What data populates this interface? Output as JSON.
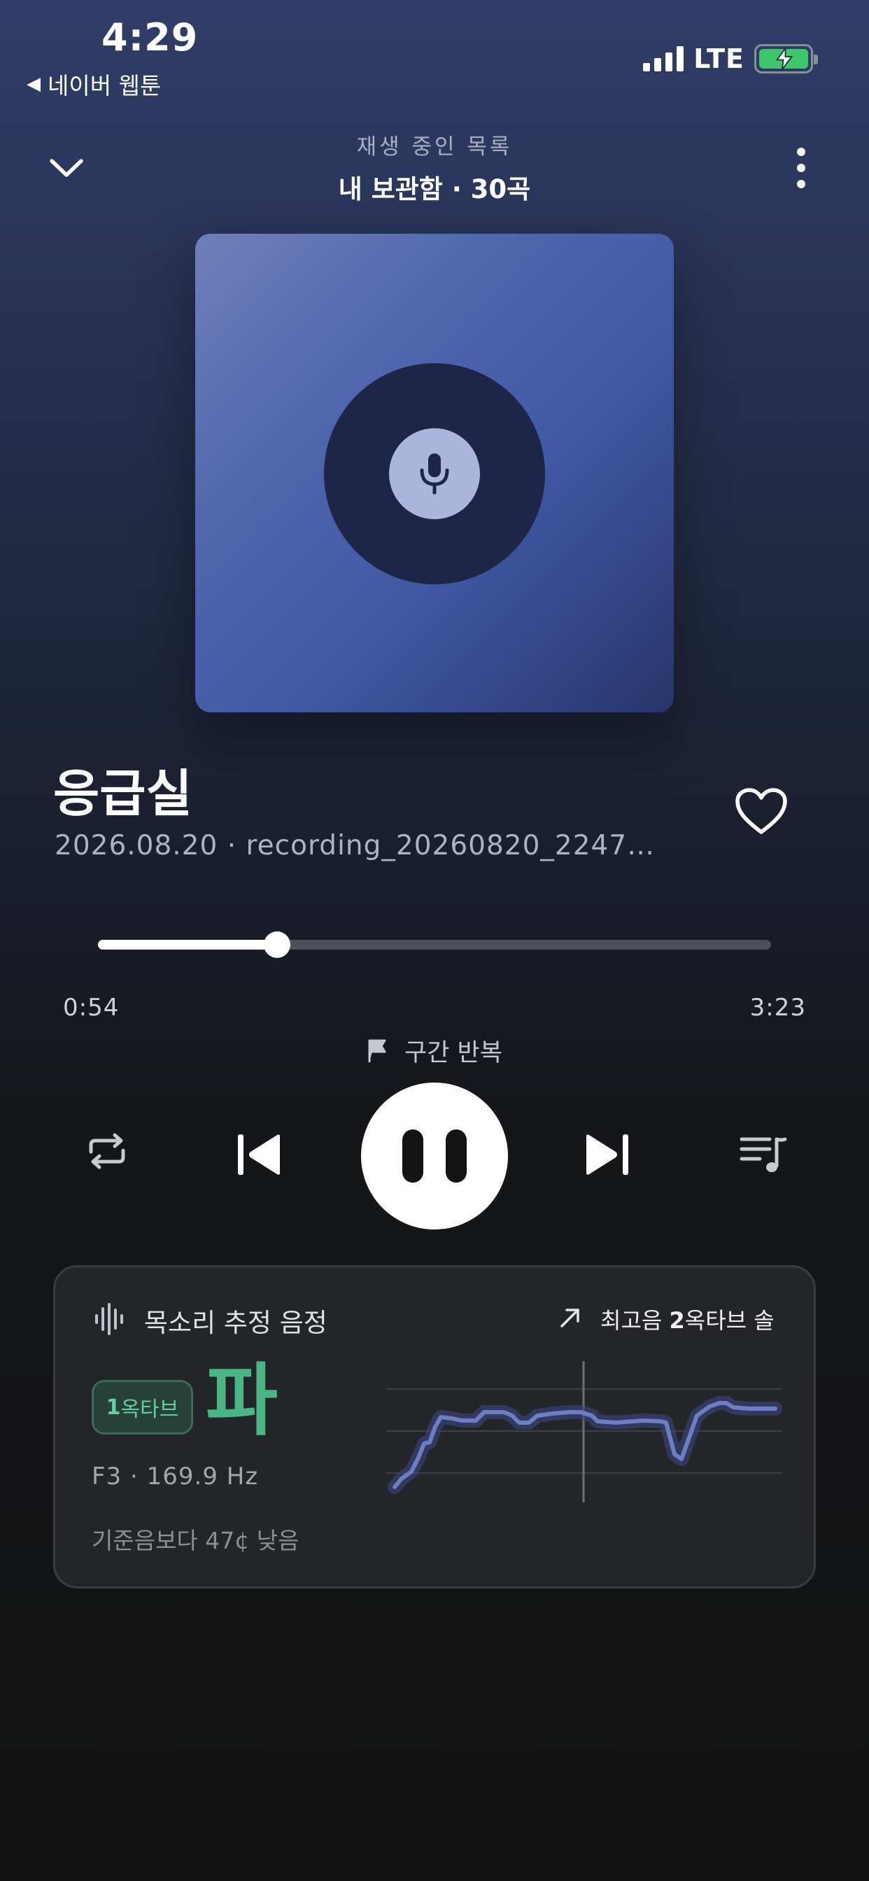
{
  "status_bar": {
    "time": "4:29",
    "back_app": "네이버 웹툰",
    "network": "LTE",
    "battery_level": 1.0,
    "battery_color": "#3ec86b"
  },
  "header": {
    "subtitle": "재생 중인 목록",
    "title": "내 보관함 · 30곡"
  },
  "album_art": {
    "icon": "microphone-icon",
    "colors": [
      "#6f7fb8",
      "#4158a5",
      "#28356a"
    ]
  },
  "track": {
    "title": "응급실",
    "meta": "2026.08.20  ·  recording_20260820_2247…",
    "liked": false
  },
  "progress": {
    "current": "0:54",
    "total": "3:23",
    "fraction": 0.266
  },
  "ab_repeat": {
    "label": "구간 반복",
    "icon": "flag-icon"
  },
  "controls": {
    "repeat_icon": "repeat-icon",
    "prev_icon": "skip-previous-icon",
    "play_state": "playing",
    "play_icon": "pause-icon",
    "next_icon": "skip-next-icon",
    "queue_icon": "queue-music-icon"
  },
  "voice_card": {
    "title": "목소리 추정 음정",
    "highest_label_prefix": "최고음 ",
    "highest_label_strong": "2",
    "highest_label_suffix": "옥타브 솔",
    "octave_badge_num": "1",
    "octave_badge_text": "옥타브",
    "note": "파",
    "note_name": "F3",
    "frequency": "169.9 Hz",
    "reference": "기준음보다 47¢ 낮음",
    "accent_color": "#49b686",
    "line_color": "#6c7fc4"
  }
}
